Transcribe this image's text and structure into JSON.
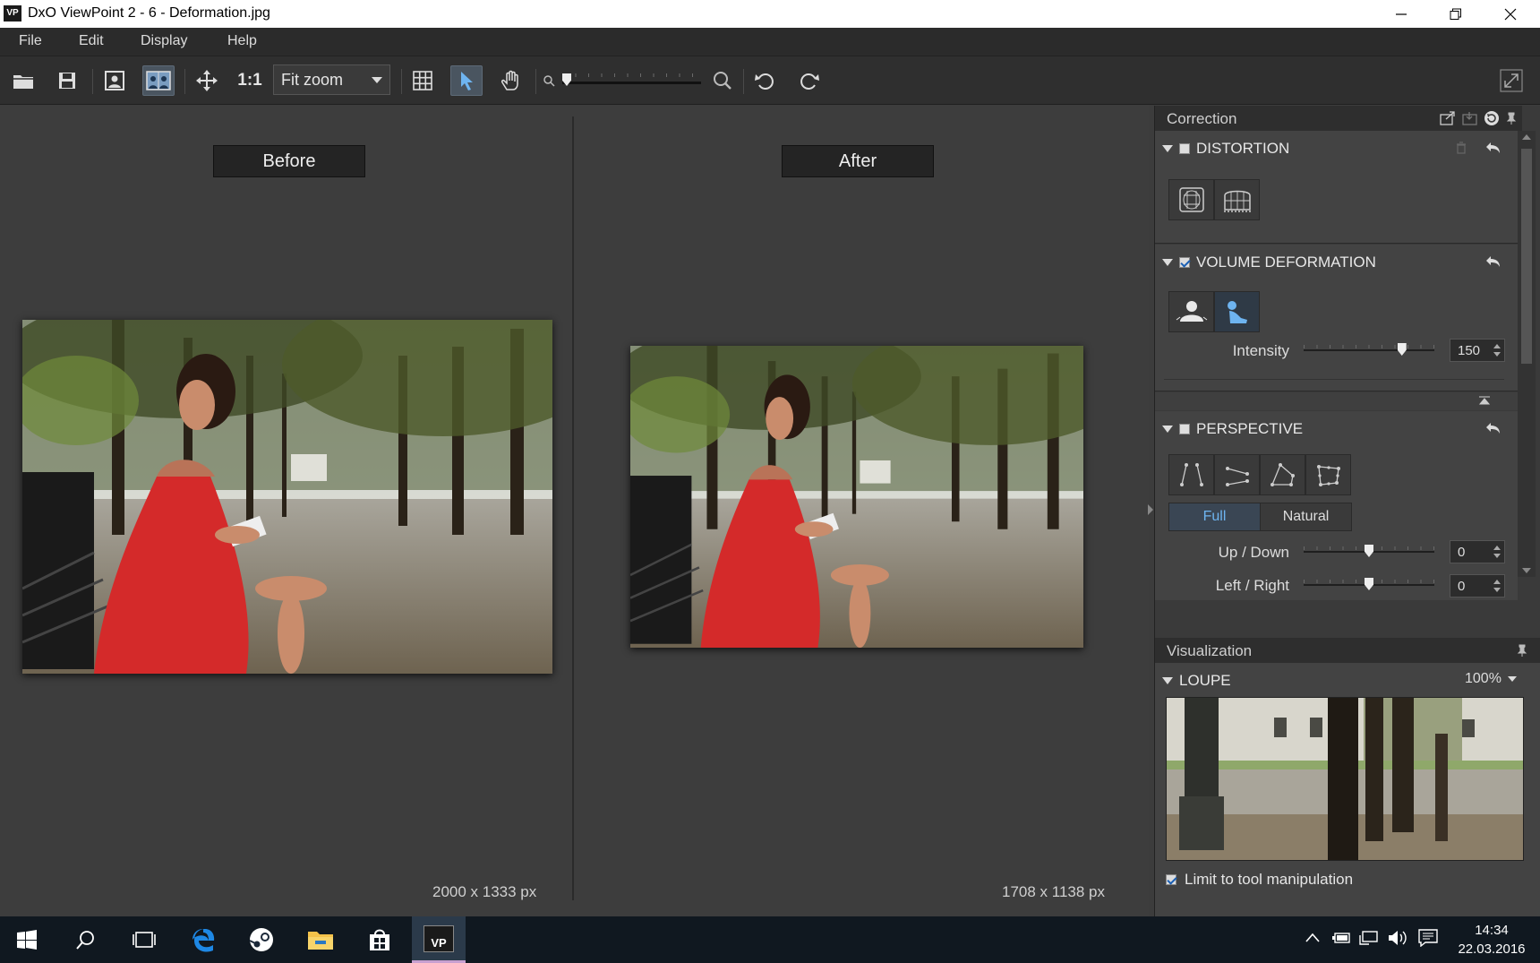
{
  "window": {
    "app_icon": "VP",
    "title": "DxO ViewPoint 2 - 6 - Deformation.jpg"
  },
  "menu": [
    "File",
    "Edit",
    "Display",
    "Help"
  ],
  "toolbar": {
    "one_to_one": "1:1",
    "zoom_select": "Fit zoom",
    "icons": [
      "open-folder-icon",
      "save-icon",
      "single-view-icon",
      "split-view-icon",
      "move-icon",
      "grid-icon",
      "pointer-icon",
      "hand-icon",
      "zoom-out-icon",
      "zoom-in-icon",
      "rotate-left-icon",
      "rotate-right-icon",
      "fullscreen-icon"
    ]
  },
  "viewer": {
    "before_label": "Before",
    "after_label": "After",
    "before_dims": "2000 x 1333 px",
    "after_dims": "1708 x 1138 px"
  },
  "correction": {
    "title": "Correction",
    "distortion": {
      "title": "DISTORTION",
      "checked": false
    },
    "volume": {
      "title": "VOLUME DEFORMATION",
      "checked": true,
      "intensity_label": "Intensity",
      "intensity_value": "150",
      "intensity_fraction": 0.77
    },
    "perspective": {
      "title": "PERSPECTIVE",
      "checked": false,
      "mode_full": "Full",
      "mode_natural": "Natural",
      "selected_mode": "Full",
      "up_down_label": "Up / Down",
      "up_down_value": "0",
      "left_right_label": "Left / Right",
      "left_right_value": "0"
    }
  },
  "visualization": {
    "title": "Visualization",
    "loupe_title": "LOUPE",
    "loupe_zoom": "100%",
    "limit_label": "Limit to tool manipulation",
    "limit_checked": true
  },
  "taskbar": {
    "time": "14:34",
    "date": "22.03.2016",
    "apps": [
      "windows-start-icon",
      "search-icon",
      "task-view-icon",
      "edge-icon",
      "steam-icon",
      "file-explorer-icon",
      "store-icon",
      "viewpoint-app-icon"
    ],
    "viewpoint_icon_text": "VP"
  },
  "colors": {
    "accent": "#4a5560",
    "background": "#3d3d3d",
    "dress": "#d42a2a"
  }
}
